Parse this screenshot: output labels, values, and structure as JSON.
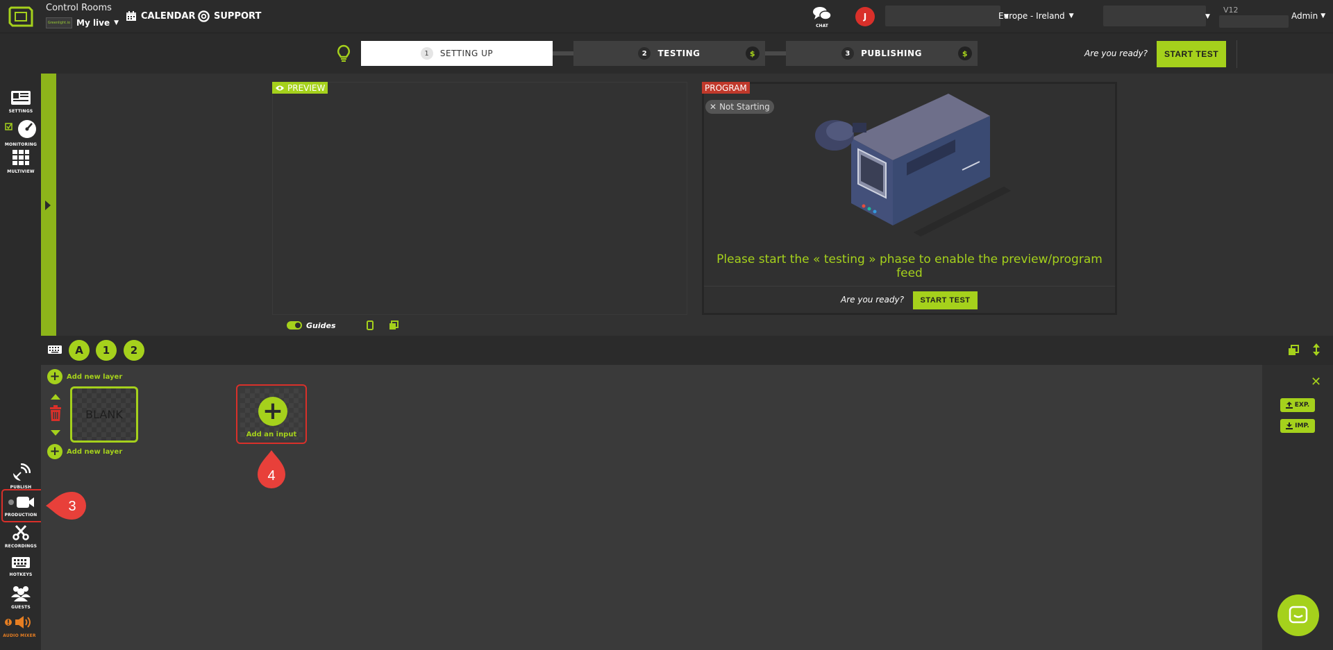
{
  "topbar": {
    "app_title": "Control Rooms",
    "live_name": "My live",
    "live_thumb_text": "Greenlight.io",
    "calendar": "CALENDAR",
    "support": "SUPPORT",
    "chat": "CHAT",
    "avatar_initial": "J",
    "region": "Europe - Ireland",
    "version": "V12",
    "admin": "Admin"
  },
  "steps": [
    {
      "num": "1",
      "label": "SETTING UP"
    },
    {
      "num": "2",
      "label": "TESTING",
      "badge": "$"
    },
    {
      "num": "3",
      "label": "PUBLISHING",
      "badge": "$"
    }
  ],
  "header_ready": "Are you ready?",
  "header_start": "START TEST",
  "sidebar": {
    "settings": "SETTINGS",
    "monitoring": "MONITORING",
    "multiview": "MULTIVIEW",
    "publish": "PUBLISH",
    "production": "PRODUCTION",
    "recordings": "RECORDINGS",
    "hotkeys": "HOTKEYS",
    "guests": "GUESTS",
    "audio_mixer": "AUDIO MIXER"
  },
  "preview": {
    "tag": "PREVIEW"
  },
  "program": {
    "tag": "PROGRAM",
    "status": "Not Starting",
    "message": "Please start the « testing » phase to enable the preview/program feed",
    "ready": "Are you ready?",
    "start": "START TEST"
  },
  "guides": "Guides",
  "layer_toolbar": {
    "a": "A",
    "one": "1",
    "two": "2"
  },
  "layers": {
    "add_top": "Add new layer",
    "add_bottom": "Add new layer",
    "blank": "BLANK",
    "add_input": "Add an input"
  },
  "right_panel": {
    "export": "EXP.",
    "import": "IMP."
  },
  "markers": {
    "three": "3",
    "four": "4"
  },
  "colors": {
    "accent": "#a5d11c",
    "danger": "#d9302a",
    "bg": "#2b2b2b"
  }
}
